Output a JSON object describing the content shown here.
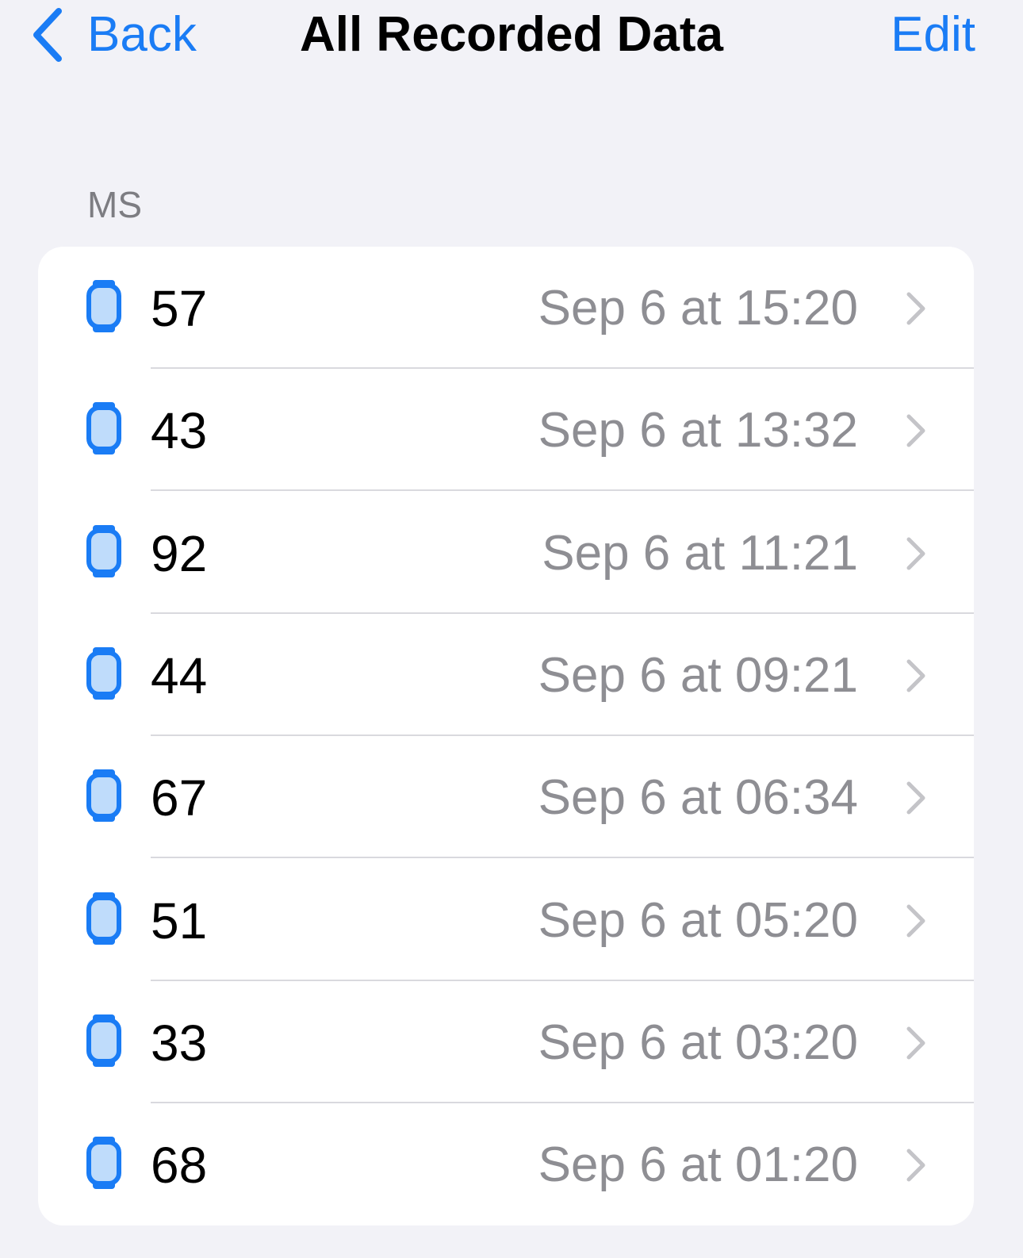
{
  "nav": {
    "back_label": "Back",
    "title": "All Recorded Data",
    "edit_label": "Edit"
  },
  "section": {
    "header": "MS"
  },
  "colors": {
    "accent": "#1a7cf5",
    "watch_fill": "#bfdcfb",
    "secondary_text": "#8e8e93",
    "background": "#f2f2f7"
  },
  "records": [
    {
      "value": "57",
      "date": "Sep 6 at 15:20",
      "icon": "apple-watch-icon"
    },
    {
      "value": "43",
      "date": "Sep 6 at 13:32",
      "icon": "apple-watch-icon"
    },
    {
      "value": "92",
      "date": "Sep 6 at 11:21",
      "icon": "apple-watch-icon"
    },
    {
      "value": "44",
      "date": "Sep 6 at 09:21",
      "icon": "apple-watch-icon"
    },
    {
      "value": "67",
      "date": "Sep 6 at 06:34",
      "icon": "apple-watch-icon"
    },
    {
      "value": "51",
      "date": "Sep 6 at 05:20",
      "icon": "apple-watch-icon"
    },
    {
      "value": "33",
      "date": "Sep 6 at 03:20",
      "icon": "apple-watch-icon"
    },
    {
      "value": "68",
      "date": "Sep 6 at 01:20",
      "icon": "apple-watch-icon"
    }
  ]
}
